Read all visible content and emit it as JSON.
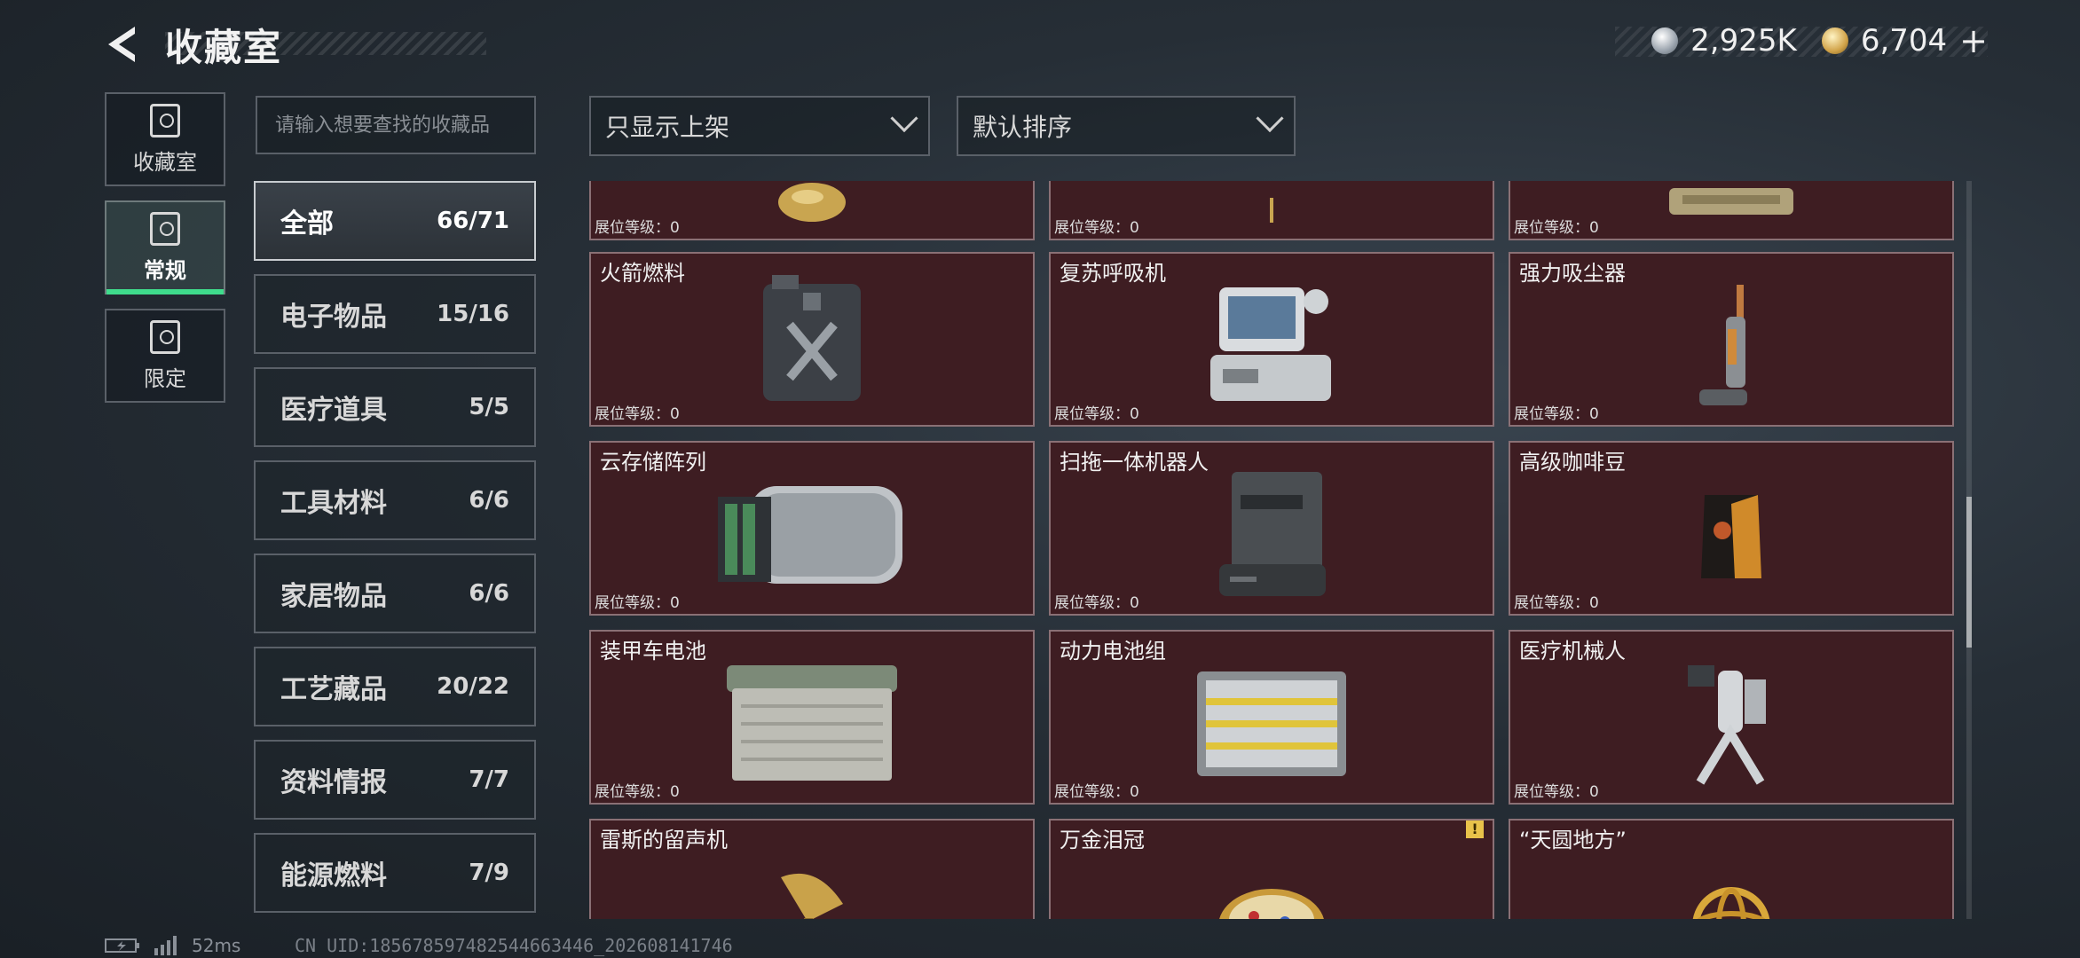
{
  "header": {
    "title": "收藏室",
    "currencies": [
      {
        "icon": "silver-coin-icon",
        "value": "2,925K"
      },
      {
        "icon": "gold-coin-icon",
        "value": "6,704"
      }
    ],
    "add_label": "+"
  },
  "nav": [
    {
      "label": "收藏室",
      "icon": "vault-icon",
      "active": false
    },
    {
      "label": "常规",
      "icon": "document-icon",
      "active": true
    },
    {
      "label": "限定",
      "icon": "image-icon",
      "active": false
    }
  ],
  "search": {
    "placeholder": "请输入想要查找的收藏品"
  },
  "filters": {
    "shelf": "只显示上架",
    "sort": "默认排序"
  },
  "categories": [
    {
      "name": "全部",
      "count": "66/71"
    },
    {
      "name": "电子物品",
      "count": "15/16"
    },
    {
      "name": "医疗道具",
      "count": "5/5"
    },
    {
      "name": "工具材料",
      "count": "6/6"
    },
    {
      "name": "家居物品",
      "count": "6/6"
    },
    {
      "name": "工艺藏品",
      "count": "20/22"
    },
    {
      "name": "资料情报",
      "count": "7/7"
    },
    {
      "name": "能源燃料",
      "count": "7/9"
    }
  ],
  "level_label": "展位等级：0",
  "items": [
    {
      "name": ""
    },
    {
      "name": ""
    },
    {
      "name": ""
    },
    {
      "name": "火箭燃料"
    },
    {
      "name": "复苏呼吸机"
    },
    {
      "name": "强力吸尘器"
    },
    {
      "name": "云存储阵列"
    },
    {
      "name": "扫拖一体机器人"
    },
    {
      "name": "高级咖啡豆"
    },
    {
      "name": "装甲车电池"
    },
    {
      "name": "动力电池组"
    },
    {
      "name": "医疗机械人"
    },
    {
      "name": "雷斯的留声机"
    },
    {
      "name": "万金泪冠",
      "warning": "!"
    },
    {
      "name": "“天圆地方”"
    }
  ],
  "footer": {
    "ping": "52ms",
    "uid": "CN UID:18567859748254466344​6_202608141746"
  }
}
